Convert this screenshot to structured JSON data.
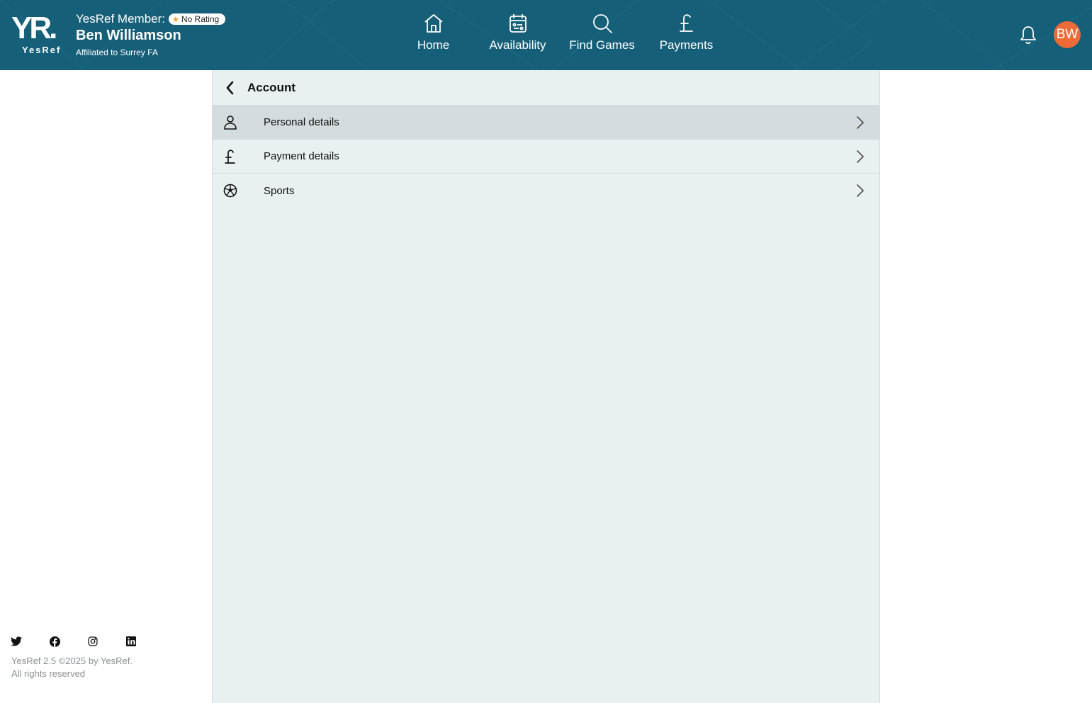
{
  "header": {
    "logo_mark": "YR.",
    "logo_sub": "YesRef",
    "member_label": "YesRef Member:",
    "rating": "No Rating",
    "name": "Ben Williamson",
    "affiliation": "Affiliated to Surrey FA",
    "avatar_initials": "BW",
    "colors": {
      "background": "#165f78",
      "avatar": "#ee6a37",
      "star": "#f39a1c"
    }
  },
  "nav": {
    "items": [
      {
        "label": "Home",
        "icon": "home-icon"
      },
      {
        "label": "Availability",
        "icon": "calendar-icon"
      },
      {
        "label": "Find Games",
        "icon": "search-icon"
      },
      {
        "label": "Payments",
        "icon": "pound-icon"
      }
    ]
  },
  "panel": {
    "title": "Account",
    "rows": [
      {
        "label": "Personal details",
        "icon": "person-icon",
        "active": true
      },
      {
        "label": "Payment details",
        "icon": "pound-icon",
        "active": false
      },
      {
        "label": "Sports",
        "icon": "football-icon",
        "active": false
      }
    ]
  },
  "footer": {
    "socials": [
      "twitter-icon",
      "facebook-icon",
      "instagram-icon",
      "linkedin-icon"
    ],
    "line1": "YesRef 2.5 ©2025 by YesRef.",
    "line2": "All rights reserved"
  }
}
